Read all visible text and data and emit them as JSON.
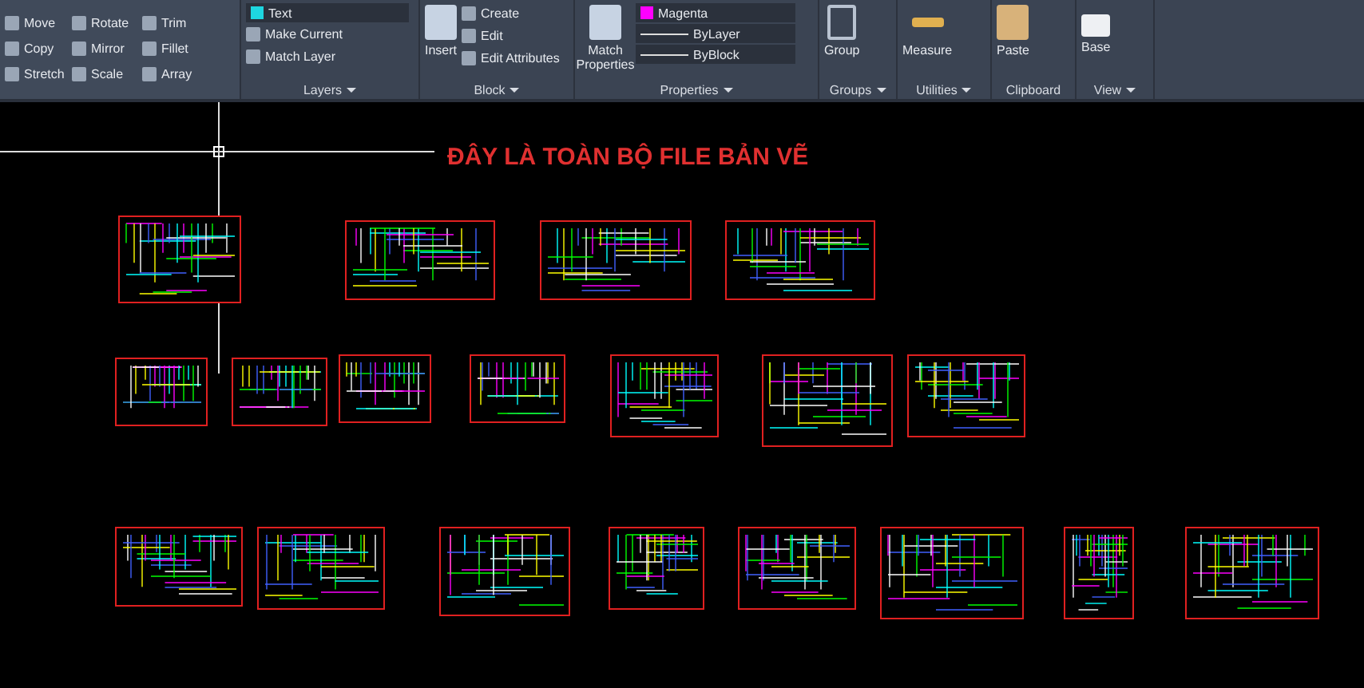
{
  "ribbon": {
    "modify": {
      "tools": [
        {
          "label": "Move"
        },
        {
          "label": "Rotate"
        },
        {
          "label": "Trim"
        },
        {
          "label": "Copy"
        },
        {
          "label": "Mirror"
        },
        {
          "label": "Fillet"
        },
        {
          "label": "Stretch"
        },
        {
          "label": "Scale"
        },
        {
          "label": "Array"
        }
      ]
    },
    "layers": {
      "title": "Layers",
      "layer_dropdown": "Text",
      "tools": [
        "Make Current",
        "Match Layer"
      ]
    },
    "block": {
      "title": "Block",
      "insert": "Insert",
      "tools": [
        "Create",
        "Edit",
        "Edit Attributes"
      ]
    },
    "properties": {
      "title": "Properties",
      "match": "Match Properties",
      "color_dropdown": "Magenta",
      "linetype_dropdown": "ByLayer",
      "lineweight_dropdown": "ByBlock"
    },
    "groups": {
      "title": "Groups",
      "group": "Group"
    },
    "utilities": {
      "title": "Utilities",
      "measure": "Measure"
    },
    "clipboard": {
      "title": "Clipboard",
      "paste": "Paste"
    },
    "view": {
      "title": "View",
      "base": "Base"
    }
  },
  "canvas": {
    "heading": "ĐÂY LÀ TOÀN BỘ FILE BẢN VẼ"
  }
}
